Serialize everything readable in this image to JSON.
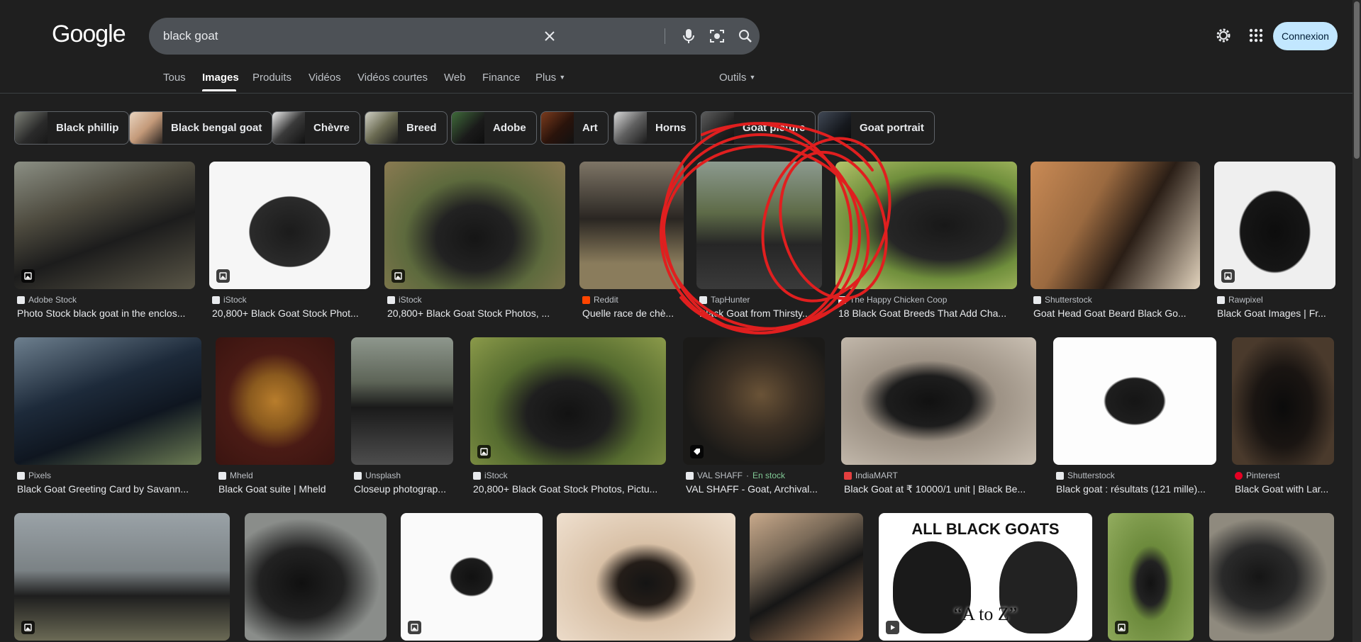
{
  "header": {
    "logo": "Google",
    "search_value": "black goat",
    "signin_label": "Connexion"
  },
  "tabs": [
    {
      "label": "Tous"
    },
    {
      "label": "Images"
    },
    {
      "label": "Produits"
    },
    {
      "label": "Vidéos"
    },
    {
      "label": "Vidéos courtes"
    },
    {
      "label": "Web"
    },
    {
      "label": "Finance"
    },
    {
      "label": "Plus"
    }
  ],
  "tools_label": "Outils",
  "chips": [
    {
      "label": "Black phillip"
    },
    {
      "label": "Black bengal goat"
    },
    {
      "label": "Chèvre"
    },
    {
      "label": "Breed"
    },
    {
      "label": "Adobe"
    },
    {
      "label": "Art"
    },
    {
      "label": "Horns"
    },
    {
      "label": "Goat picture"
    },
    {
      "label": "Goat portrait"
    }
  ],
  "results": [
    {
      "source": "Adobe Stock",
      "title": "Photo Stock black goat in the enclos..."
    },
    {
      "source": "iStock",
      "title": "20,800+ Black Goat Stock Phot..."
    },
    {
      "source": "iStock",
      "title": "20,800+ Black Goat Stock Photos, ..."
    },
    {
      "source": "Reddit",
      "title": "Quelle race de chè..."
    },
    {
      "source": "TapHunter",
      "title": "Black Goat from Thirsty..."
    },
    {
      "source": "The Happy Chicken Coop",
      "title": "18 Black Goat Breeds That Add Cha..."
    },
    {
      "source": "Shutterstock",
      "title": "Goat Head Goat Beard Black Go..."
    },
    {
      "source": "Rawpixel",
      "title": "Black Goat Images | Fr..."
    },
    {
      "source": "Pixels",
      "title": "Black Goat Greeting Card by Savann..."
    },
    {
      "source": "Mheld",
      "title": "Black Goat suite | Mheld"
    },
    {
      "source": "Unsplash",
      "title": "Closeup photograp..."
    },
    {
      "source": "iStock",
      "title": "20,800+ Black Goat Stock Photos, Pictu..."
    },
    {
      "source": "VAL SHAFF",
      "stock": "En stock",
      "title": "VAL SHAFF - Goat, Archival..."
    },
    {
      "source": "IndiaMART",
      "title": "Black Goat at ₹ 10000/1 unit | Black Be..."
    },
    {
      "source": "Shutterstock",
      "title": "Black goat : résultats (121 mille)..."
    },
    {
      "source": "Pinterest",
      "title": "Black Goat with Lar..."
    }
  ],
  "row3_caption": {
    "line1": "ALL BLACK GOATS",
    "line2": "“A to Z”"
  },
  "colors": {
    "background": "#1f1f1f",
    "search_bg": "#4d5156",
    "signin_bg": "#c2e7ff",
    "annotation": "#e01f1f"
  }
}
